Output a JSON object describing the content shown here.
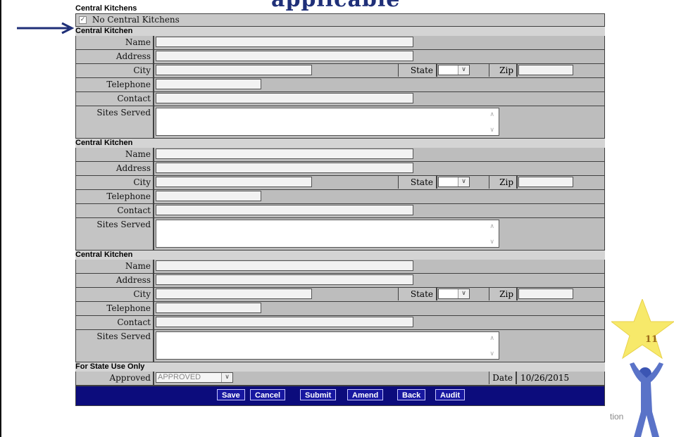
{
  "slide_title": "applicable",
  "page_number": "11",
  "footer_fragment": "tion",
  "section_title": "Central Kitchens",
  "no_central_kitchens_label": "No Central Kitchens",
  "kitchen_title": "Central Kitchen",
  "labels": {
    "name": "Name",
    "address": "Address",
    "city": "City",
    "state": "State",
    "zip": "Zip",
    "telephone": "Telephone",
    "contact": "Contact",
    "sites_served": "Sites Served"
  },
  "state_use": {
    "title": "For State Use Only",
    "approved_label": "Approved",
    "approved_value": "APPROVED",
    "date_label": "Date",
    "date_value": "10/26/2015"
  },
  "buttons": {
    "save": "Save",
    "cancel": "Cancel",
    "submit": "Submit",
    "amend": "Amend",
    "back": "Back",
    "audit": "Audit"
  },
  "colors": {
    "title": "#1f2f78",
    "button_bar": "#0c0c7c",
    "arrow": "#1f2f78",
    "star": "#f7e96a"
  }
}
